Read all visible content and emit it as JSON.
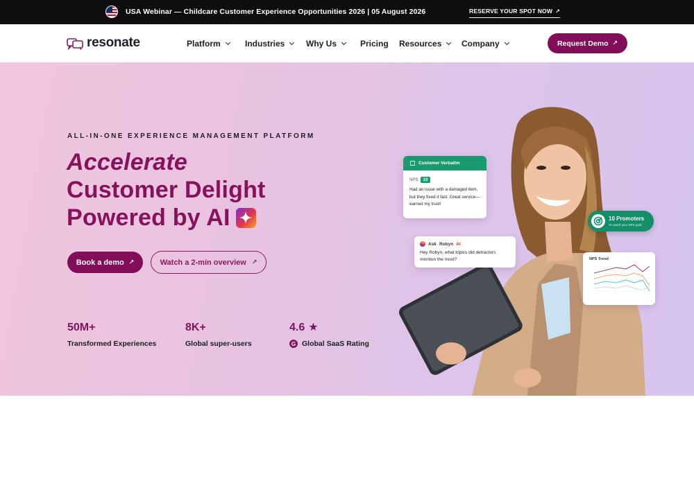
{
  "announcement": {
    "text": "USA Webinar — Childcare Customer Experience Opportunities 2026 | 05 August 2026",
    "cta": "RESERVE YOUR SPOT NOW",
    "cta_icon": "arrow-up-right-icon"
  },
  "nav": {
    "logo": "resonate",
    "items": [
      {
        "label": "Platform",
        "dropdown": true
      },
      {
        "label": "Industries",
        "dropdown": true
      },
      {
        "label": "Why Us",
        "dropdown": true
      },
      {
        "label": "Pricing",
        "dropdown": false
      },
      {
        "label": "Resources",
        "dropdown": true
      },
      {
        "label": "Company",
        "dropdown": true
      }
    ],
    "cta": "Request Demo"
  },
  "hero": {
    "eyebrow": "ALL-IN-ONE EXPERIENCE MANAGEMENT PLATFORM",
    "headline_1": "Accelerate",
    "headline_2": "Customer Delight",
    "headline_3": "Powered by AI",
    "primary_cta": "Book a demo",
    "secondary_cta": "Watch a 2-min overview",
    "stats": [
      {
        "value": "50M+",
        "label": "Transformed Experiences"
      },
      {
        "value": "8K+",
        "label": "Global super-users"
      },
      {
        "value": "4.6",
        "label": "Global SaaS Rating",
        "icon": "star-icon"
      }
    ]
  },
  "illustration": {
    "verbatim": {
      "title": "Customer Verbatim",
      "nps_label": "NPS",
      "nps_value": "10",
      "quote": "Had an issue with a damaged item, but they fixed it fast. Great service—earned my trust!"
    },
    "robyn": {
      "title_prefix": "Ask",
      "title_name": "Robyn",
      "title_ai": "AI",
      "question": "Hey Robyn, what topics did detractors mention the most?"
    },
    "promoters": {
      "title": "10 Promoters",
      "subtitle": "To reach your NPS goal"
    },
    "trend": {
      "title": "NPS Trend"
    }
  },
  "colors": {
    "brand": "#820d58",
    "accent_green": "#1a9a6e",
    "topbar": "#0e0e10"
  }
}
